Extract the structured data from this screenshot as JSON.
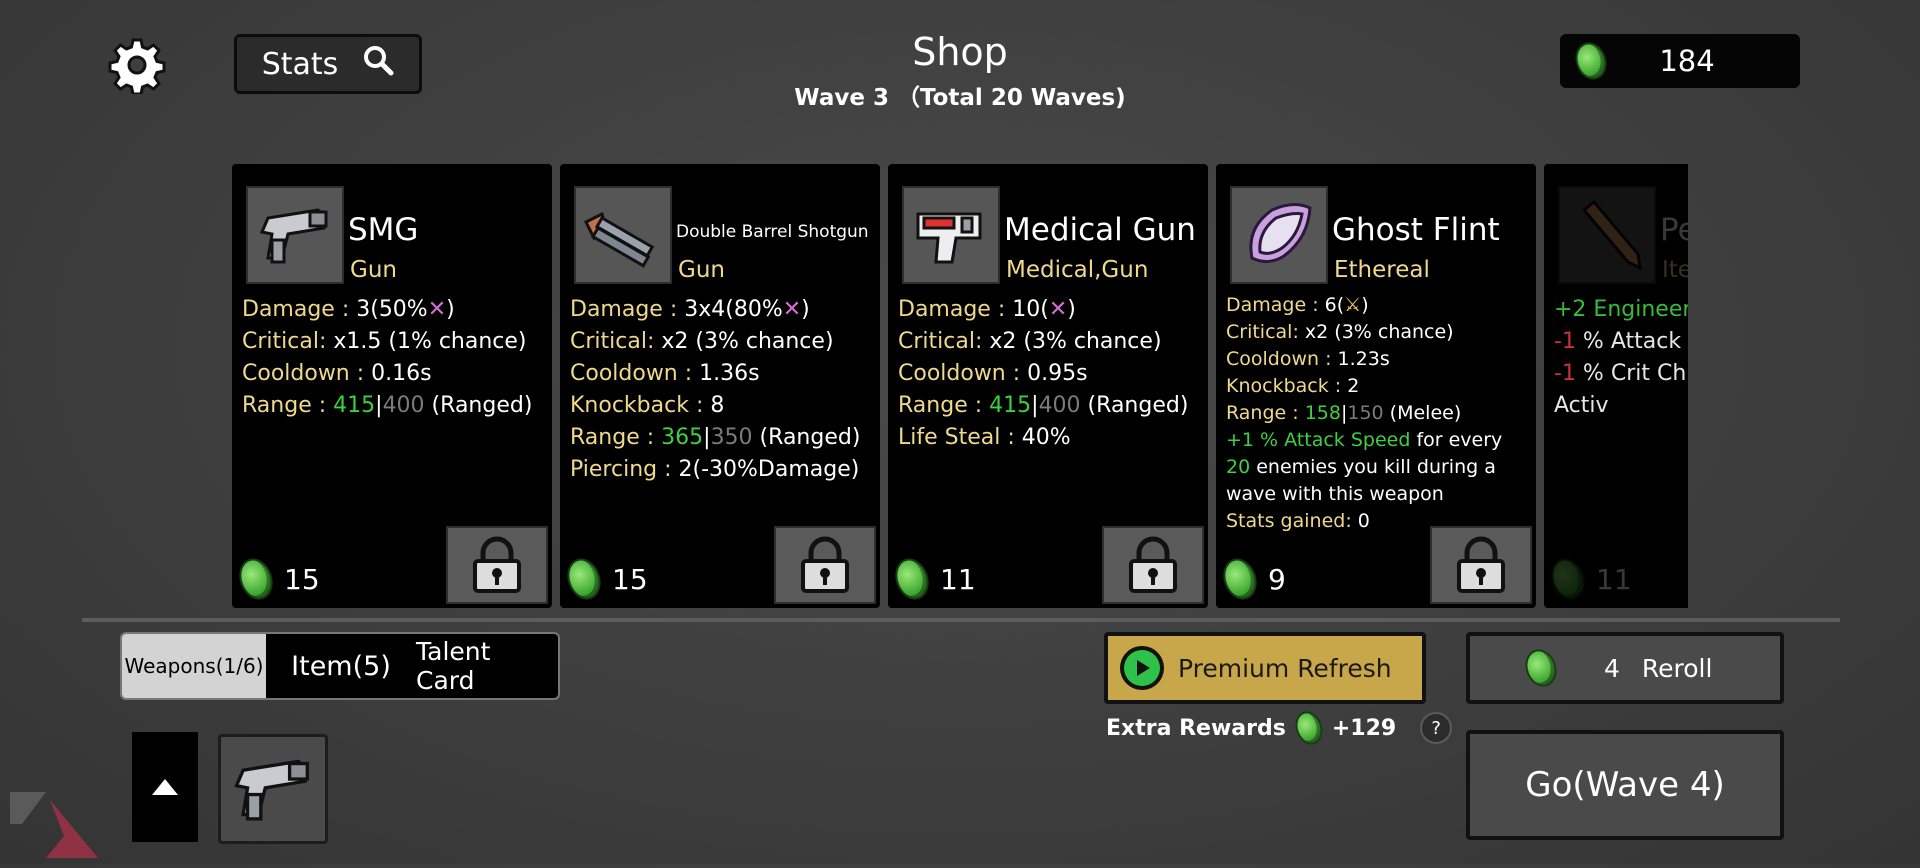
{
  "header": {
    "title": "Shop",
    "subtitle": "Wave 3 （Total 20 Waves)",
    "stats_label": "Stats",
    "coins": "184"
  },
  "cards": [
    {
      "name": "SMG",
      "type": "Gun",
      "price": "15",
      "icon": "smg-icon",
      "stats": [
        [
          {
            "t": "Damage : ",
            "c": "k"
          },
          {
            "t": "3(50%",
            "c": ""
          },
          {
            "t": "✕",
            "c": "pk"
          },
          {
            "t": ")",
            "c": ""
          }
        ],
        [
          {
            "t": "Critical: ",
            "c": "k"
          },
          {
            "t": "x1.5 (1% chance)",
            "c": ""
          }
        ],
        [
          {
            "t": "Cooldown : ",
            "c": "k"
          },
          {
            "t": "0.16s",
            "c": ""
          }
        ],
        [
          {
            "t": "Range : ",
            "c": "k"
          },
          {
            "t": "415",
            "c": "g"
          },
          {
            "t": "|",
            "c": ""
          },
          {
            "t": "400",
            "c": "gr"
          },
          {
            "t": " (Ranged)",
            "c": ""
          }
        ]
      ]
    },
    {
      "name": "Double Barrel Shotgun",
      "type": "Gun",
      "price": "15",
      "icon": "shotgun-icon",
      "stats": [
        [
          {
            "t": "Damage : ",
            "c": "k"
          },
          {
            "t": "3x4(80%",
            "c": ""
          },
          {
            "t": "✕",
            "c": "pk"
          },
          {
            "t": ")",
            "c": ""
          }
        ],
        [
          {
            "t": "Critical: ",
            "c": "k"
          },
          {
            "t": "x2 (3% chance)",
            "c": ""
          }
        ],
        [
          {
            "t": "Cooldown : ",
            "c": "k"
          },
          {
            "t": "1.36s",
            "c": ""
          }
        ],
        [
          {
            "t": "Knockback : ",
            "c": "k"
          },
          {
            "t": "8",
            "c": ""
          }
        ],
        [
          {
            "t": "Range : ",
            "c": "k"
          },
          {
            "t": "365",
            "c": "g"
          },
          {
            "t": "|",
            "c": ""
          },
          {
            "t": "350",
            "c": "gr"
          },
          {
            "t": " (Ranged)",
            "c": ""
          }
        ],
        [
          {
            "t": "Piercing : ",
            "c": "k"
          },
          {
            "t": "2(-30%Damage)",
            "c": ""
          }
        ]
      ]
    },
    {
      "name": "Medical Gun",
      "type": "Medical,Gun",
      "price": "11",
      "icon": "medical-gun-icon",
      "stats": [
        [
          {
            "t": "Damage : ",
            "c": "k"
          },
          {
            "t": "10(",
            "c": ""
          },
          {
            "t": "✕",
            "c": "pk"
          },
          {
            "t": ")",
            "c": ""
          }
        ],
        [
          {
            "t": "Critical: ",
            "c": "k"
          },
          {
            "t": "x2 (3% chance)",
            "c": ""
          }
        ],
        [
          {
            "t": "Cooldown : ",
            "c": "k"
          },
          {
            "t": "0.95s",
            "c": ""
          }
        ],
        [
          {
            "t": "Range : ",
            "c": "k"
          },
          {
            "t": "415",
            "c": "g"
          },
          {
            "t": "|",
            "c": ""
          },
          {
            "t": "400",
            "c": "gr"
          },
          {
            "t": " (Ranged)",
            "c": ""
          }
        ],
        [
          {
            "t": "Life Steal : ",
            "c": "k"
          },
          {
            "t": "40%",
            "c": ""
          }
        ]
      ]
    },
    {
      "name": "Ghost Flint",
      "type": "Ethereal",
      "price": "9",
      "icon": "ghost-flint-icon",
      "stats": [
        [
          {
            "t": "Damage : ",
            "c": "k"
          },
          {
            "t": "6(",
            "c": ""
          },
          {
            "t": "⚔",
            "c": "yl"
          },
          {
            "t": ")",
            "c": ""
          }
        ],
        [
          {
            "t": "Critical: ",
            "c": "k"
          },
          {
            "t": "x2 (3% chance)",
            "c": ""
          }
        ],
        [
          {
            "t": "Cooldown : ",
            "c": "k"
          },
          {
            "t": "1.23s",
            "c": ""
          }
        ],
        [
          {
            "t": "Knockback : ",
            "c": "k"
          },
          {
            "t": "2",
            "c": ""
          }
        ],
        [
          {
            "t": "Range : ",
            "c": "k"
          },
          {
            "t": "158",
            "c": "g"
          },
          {
            "t": "|",
            "c": ""
          },
          {
            "t": "150",
            "c": "gr"
          },
          {
            "t": " (Melee)",
            "c": ""
          }
        ],
        [
          {
            "t": "+1  % Attack Speed",
            "c": "g"
          },
          {
            "t": " for every",
            "c": ""
          }
        ],
        [
          {
            "t": "20",
            "c": "g"
          },
          {
            "t": " enemies you kill during a",
            "c": ""
          }
        ],
        [
          {
            "t": "wave with this weapon",
            "c": ""
          }
        ],
        [
          {
            "t": "Stats gained: ",
            "c": "k"
          },
          {
            "t": "0",
            "c": ""
          }
        ]
      ]
    },
    {
      "name": "Pe",
      "type": "Ite",
      "price": "11",
      "icon": "pencil-icon",
      "stats": [
        [
          {
            "t": "+2 Engineer",
            "c": "g"
          }
        ],
        [
          {
            "t": "-1",
            "c": "r"
          },
          {
            "t": " % Attack",
            "c": ""
          }
        ],
        [
          {
            "t": "-1",
            "c": "r"
          },
          {
            "t": " % Crit Ch",
            "c": ""
          }
        ],
        [
          {
            "t": "Activ",
            "c": ""
          }
        ]
      ]
    }
  ],
  "tabs": {
    "weapons": "Weapons(1/6)",
    "items": "Item(5)",
    "talent": "Talent Card"
  },
  "actions": {
    "premium_refresh": "Premium Refresh",
    "extra_rewards_label": "Extra Rewards",
    "extra_rewards_value": "+129",
    "help": "?",
    "reroll_cost": "4",
    "reroll_label": "Reroll",
    "go_label": "Go(Wave 4)"
  },
  "colors": {
    "stat_key": "#f0d98c",
    "positive": "#3ed03e",
    "base_value": "#7b7b7b",
    "premium": "#c8a74a"
  }
}
